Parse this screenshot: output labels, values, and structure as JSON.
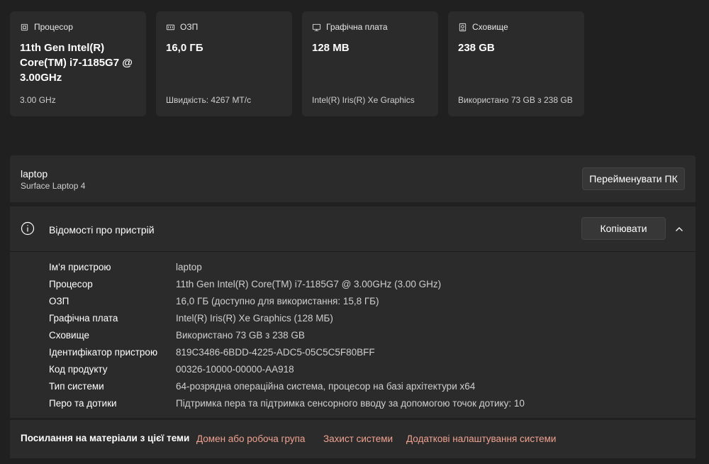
{
  "cards": [
    {
      "icon": "cpu-icon",
      "title": "Процесор",
      "value": "11th Gen Intel(R) Core(TM) i7-1185G7 @ 3.00GHz",
      "sub": "3.00 GHz"
    },
    {
      "icon": "ram-icon",
      "title": "ОЗП",
      "value": "16,0 ГБ",
      "sub": "Швидкість: 4267 МТ/с"
    },
    {
      "icon": "gpu-icon",
      "title": "Графічна плата",
      "value": "128 MB",
      "sub": "Intel(R) Iris(R) Xe Graphics"
    },
    {
      "icon": "storage-icon",
      "title": "Сховище",
      "value": "238 GB",
      "sub": "Використано 73 GB з 238 GB"
    }
  ],
  "device": {
    "name": "laptop",
    "model": "Surface Laptop 4",
    "rename_label": "Перейменувати ПК"
  },
  "specs": {
    "title": "Відомості про пристрій",
    "copy_label": "Копіювати",
    "rows": [
      {
        "label": "Ім’я пристрою",
        "value": "laptop"
      },
      {
        "label": "Процесор",
        "value": "11th Gen Intel(R) Core(TM) i7-1185G7 @ 3.00GHz (3.00 GHz)"
      },
      {
        "label": "ОЗП",
        "value": "16,0 ГБ (доступно для використання: 15,8 ГБ)"
      },
      {
        "label": "Графічна плата",
        "value": "Intel(R) Iris(R) Xe Graphics (128 МБ)"
      },
      {
        "label": "Сховище",
        "value": "Використано 73 GB з 238 GB"
      },
      {
        "label": "Ідентифікатор пристрою",
        "value": "819C3486-6BDD-4225-ADC5-05C5C5F80BFF"
      },
      {
        "label": "Код продукту",
        "value": "00326-10000-00000-AA918"
      },
      {
        "label": "Тип системи",
        "value": "64-розрядна операційна система, процесор на базі архітектури x64"
      },
      {
        "label": "Перо та дотики",
        "value": "Підтримка пера та підтримка сенсорного вводу за допомогою точок дотику: 10"
      }
    ]
  },
  "related": {
    "title": "Посилання на матеріали з цієї теми",
    "links": [
      "Домен або робоча група",
      "Захист системи",
      "Додаткові налаштування системи"
    ]
  },
  "colors": {
    "background": "#202020",
    "card": "#2b2b2b",
    "link": "#f0a290"
  }
}
